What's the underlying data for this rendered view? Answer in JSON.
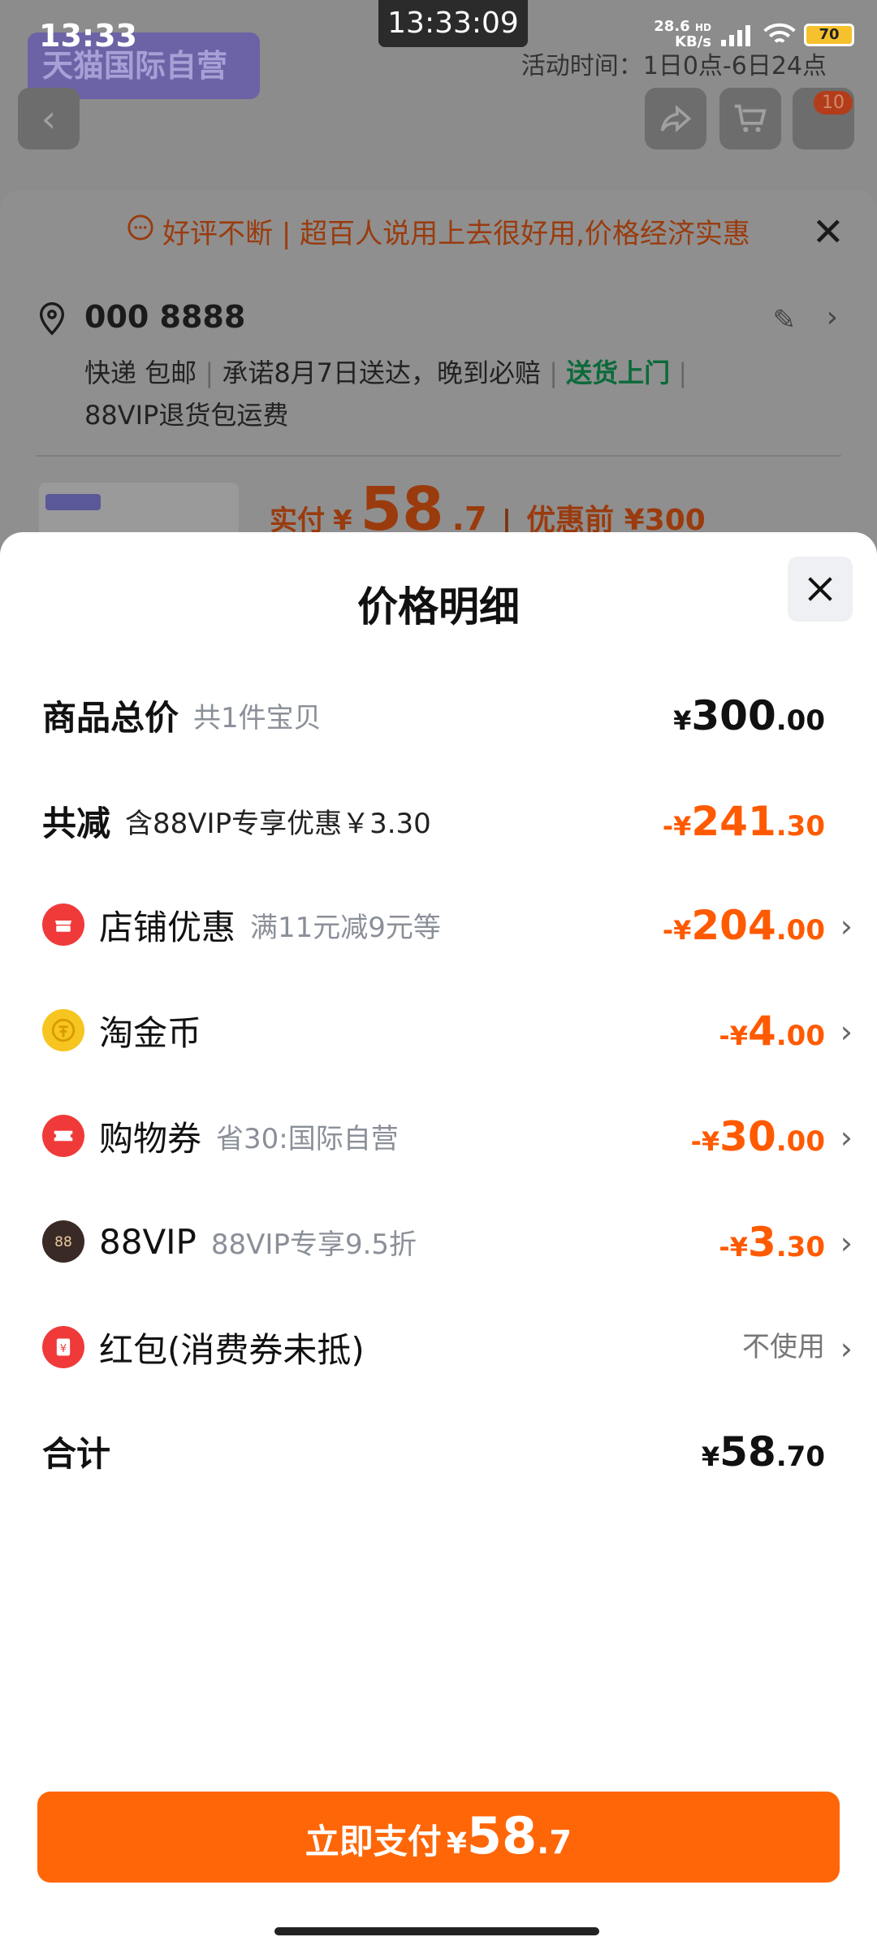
{
  "status_bar": {
    "time": "13:33",
    "center_time": "13:33:09",
    "net_speed_value": "28.6",
    "net_speed_unit": "KB/s",
    "net_type": "HD",
    "battery": "70"
  },
  "background": {
    "brand": "天猫国际自营",
    "activity_time": "活动时间：1日0点-6日24点",
    "cart_count": "10",
    "banner": "好评不断 | 超百人说用上去很好用,价格经济实惠",
    "address_name": "000 8888",
    "delivery_line": {
      "express": "快递 包邮",
      "promise": "承诺8月7日送达，晚到必赔",
      "door": "送货上门"
    },
    "delivery_line2": "88VIP退货包运费",
    "price_strip": {
      "paid_label": "实付",
      "currency": "¥",
      "paid_int": "58",
      "paid_dec": ".7",
      "before_label": "优惠前 ¥300"
    }
  },
  "sheet": {
    "title": "价格明细",
    "rows": [
      {
        "label": "商品总价",
        "sub": "共1件宝贝",
        "currency": "¥",
        "int": "300",
        "dec": ".00"
      },
      {
        "label": "共减",
        "sub": "含88VIP专享优惠￥3.30",
        "currency": "-¥",
        "int": "241",
        "dec": ".30"
      },
      {
        "label": "店铺优惠",
        "sub": "满11元减9元等",
        "currency": "-¥",
        "int": "204",
        "dec": ".00"
      },
      {
        "label": "淘金币",
        "sub": "",
        "currency": "-¥",
        "int": "4",
        "dec": ".00"
      },
      {
        "label": "购物券",
        "sub": "省30:国际自营",
        "currency": "-¥",
        "int": "30",
        "dec": ".00"
      },
      {
        "label": "88VIP",
        "sub": "88VIP专享9.5折",
        "currency": "-¥",
        "int": "3",
        "dec": ".30"
      },
      {
        "label": "红包(消费券未抵)",
        "sub": "",
        "value_text": "不使用"
      },
      {
        "label": "合计",
        "sub": "",
        "currency": "¥",
        "int": "58",
        "dec": ".70"
      }
    ]
  },
  "pay_button": {
    "label": "立即支付",
    "currency": "¥",
    "int": "58",
    "dec": ".7"
  },
  "colors": {
    "accent": "#ff6608",
    "discount": "#ff5a00",
    "shop_icon": "#f03a3a",
    "coin_icon": "#f7c51f",
    "coupon_icon": "#f03a3a",
    "vip_icon": "#3a2a26",
    "redpacket_icon": "#f03a3a"
  }
}
